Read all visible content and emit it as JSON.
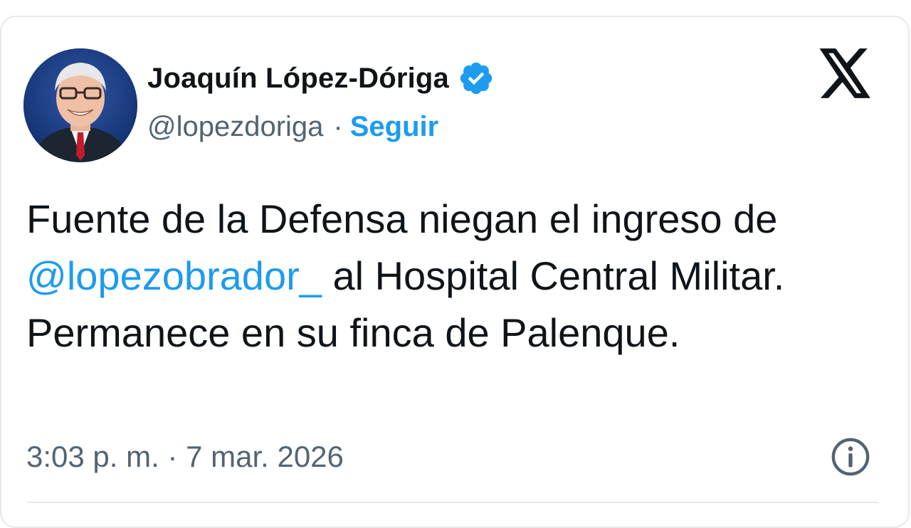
{
  "tweet": {
    "author": {
      "name": "Joaquín López-Dóriga",
      "handle": "@lopezdoriga",
      "separator": "·",
      "follow_label": "Seguir",
      "verified": true
    },
    "text_before": "Fuente de la Defensa niegan el ingreso de ",
    "mention": "@lopezobrador_",
    "text_after": " al Hospital Central Militar. Permanece en su finca de Palenque.",
    "timestamp": "3:03 p. m. · 7 mar. 2026"
  },
  "icons": {
    "platform_logo": "x-logo-icon",
    "verified_badge": "verified-badge-icon",
    "info": "info-icon"
  },
  "colors": {
    "accent": "#1d9bf0",
    "text": "#0f1419",
    "secondary_text": "#536471",
    "border": "#e6e9ec"
  }
}
